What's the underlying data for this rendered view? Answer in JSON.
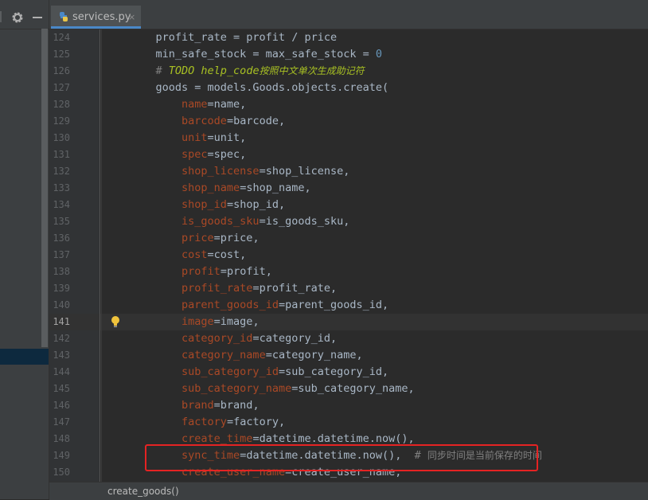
{
  "tab": {
    "file_name": "services.py",
    "close_glyph": "×",
    "icon": "python-file-icon"
  },
  "editor": {
    "current_line": 141,
    "lines": [
      {
        "n": "124",
        "parts": [
          {
            "t": "    profit_rate = profit / price",
            "c": ""
          }
        ]
      },
      {
        "n": "125",
        "parts": [
          {
            "t": "    min_safe_stock = max_safe_stock = ",
            "c": ""
          },
          {
            "t": "0",
            "c": "num"
          }
        ]
      },
      {
        "n": "126",
        "parts": [
          {
            "t": "    # ",
            "c": "cmt"
          },
          {
            "t": "TODO help_code",
            "c": "todo"
          },
          {
            "t": "按照中文单次生成助记符",
            "c": "todo cmt-cn"
          }
        ]
      },
      {
        "n": "127",
        "parts": [
          {
            "t": "    goods = models.Goods.objects.create(",
            "c": ""
          }
        ]
      },
      {
        "n": "128",
        "parts": [
          {
            "t": "        ",
            "c": ""
          },
          {
            "t": "name",
            "c": "kw"
          },
          {
            "t": "=name,",
            "c": ""
          }
        ]
      },
      {
        "n": "129",
        "parts": [
          {
            "t": "        ",
            "c": ""
          },
          {
            "t": "barcode",
            "c": "kw"
          },
          {
            "t": "=barcode,",
            "c": ""
          }
        ]
      },
      {
        "n": "130",
        "parts": [
          {
            "t": "        ",
            "c": ""
          },
          {
            "t": "unit",
            "c": "kw"
          },
          {
            "t": "=unit,",
            "c": ""
          }
        ]
      },
      {
        "n": "131",
        "parts": [
          {
            "t": "        ",
            "c": ""
          },
          {
            "t": "spec",
            "c": "kw"
          },
          {
            "t": "=spec,",
            "c": ""
          }
        ]
      },
      {
        "n": "132",
        "parts": [
          {
            "t": "        ",
            "c": ""
          },
          {
            "t": "shop_license",
            "c": "kw"
          },
          {
            "t": "=shop_license,",
            "c": ""
          }
        ]
      },
      {
        "n": "133",
        "parts": [
          {
            "t": "        ",
            "c": ""
          },
          {
            "t": "shop_name",
            "c": "kw"
          },
          {
            "t": "=shop_name,",
            "c": ""
          }
        ]
      },
      {
        "n": "134",
        "parts": [
          {
            "t": "        ",
            "c": ""
          },
          {
            "t": "shop_id",
            "c": "kw"
          },
          {
            "t": "=shop_id,",
            "c": ""
          }
        ]
      },
      {
        "n": "135",
        "parts": [
          {
            "t": "        ",
            "c": ""
          },
          {
            "t": "is_goods_sku",
            "c": "kw"
          },
          {
            "t": "=is_goods_sku,",
            "c": ""
          }
        ]
      },
      {
        "n": "136",
        "parts": [
          {
            "t": "        ",
            "c": ""
          },
          {
            "t": "price",
            "c": "kw"
          },
          {
            "t": "=price,",
            "c": ""
          }
        ]
      },
      {
        "n": "137",
        "parts": [
          {
            "t": "        ",
            "c": ""
          },
          {
            "t": "cost",
            "c": "kw"
          },
          {
            "t": "=cost,",
            "c": ""
          }
        ]
      },
      {
        "n": "138",
        "parts": [
          {
            "t": "        ",
            "c": ""
          },
          {
            "t": "profit",
            "c": "kw"
          },
          {
            "t": "=profit,",
            "c": ""
          }
        ]
      },
      {
        "n": "139",
        "parts": [
          {
            "t": "        ",
            "c": ""
          },
          {
            "t": "profit_rate",
            "c": "kw"
          },
          {
            "t": "=profit_rate,",
            "c": ""
          }
        ]
      },
      {
        "n": "140",
        "parts": [
          {
            "t": "        ",
            "c": ""
          },
          {
            "t": "parent_goods_id",
            "c": "kw"
          },
          {
            "t": "=parent_goods_id,",
            "c": ""
          }
        ]
      },
      {
        "n": "141",
        "parts": [
          {
            "t": "        ",
            "c": ""
          },
          {
            "t": "image",
            "c": "kw"
          },
          {
            "t": "=image,",
            "c": ""
          }
        ]
      },
      {
        "n": "142",
        "parts": [
          {
            "t": "        ",
            "c": ""
          },
          {
            "t": "category_id",
            "c": "kw"
          },
          {
            "t": "=category_id,",
            "c": ""
          }
        ]
      },
      {
        "n": "143",
        "parts": [
          {
            "t": "        ",
            "c": ""
          },
          {
            "t": "category_name",
            "c": "kw"
          },
          {
            "t": "=category_name,",
            "c": ""
          }
        ]
      },
      {
        "n": "144",
        "parts": [
          {
            "t": "        ",
            "c": ""
          },
          {
            "t": "sub_category_id",
            "c": "kw"
          },
          {
            "t": "=sub_category_id,",
            "c": ""
          }
        ]
      },
      {
        "n": "145",
        "parts": [
          {
            "t": "        ",
            "c": ""
          },
          {
            "t": "sub_category_name",
            "c": "kw"
          },
          {
            "t": "=sub_category_name,",
            "c": ""
          }
        ]
      },
      {
        "n": "146",
        "parts": [
          {
            "t": "        ",
            "c": ""
          },
          {
            "t": "brand",
            "c": "kw"
          },
          {
            "t": "=brand,",
            "c": ""
          }
        ]
      },
      {
        "n": "147",
        "parts": [
          {
            "t": "        ",
            "c": ""
          },
          {
            "t": "factory",
            "c": "kw"
          },
          {
            "t": "=factory,",
            "c": ""
          }
        ]
      },
      {
        "n": "148",
        "parts": [
          {
            "t": "        ",
            "c": ""
          },
          {
            "t": "create_time",
            "c": "kw"
          },
          {
            "t": "=datetime.datetime.now(),",
            "c": ""
          }
        ]
      },
      {
        "n": "149",
        "parts": [
          {
            "t": "        ",
            "c": ""
          },
          {
            "t": "sync_time",
            "c": "kw"
          },
          {
            "t": "=datetime.datetime.now(),  ",
            "c": ""
          },
          {
            "t": "# ",
            "c": "cmt"
          },
          {
            "t": "同步时间是当前保存的时间",
            "c": "cmt cmt-cn"
          }
        ]
      },
      {
        "n": "150",
        "parts": [
          {
            "t": "        ",
            "c": ""
          },
          {
            "t": "create_user_name",
            "c": "kw"
          },
          {
            "t": "=create_user_name,",
            "c": ""
          }
        ]
      }
    ]
  },
  "breadcrumb": {
    "label": "create_goods()"
  },
  "colors": {
    "keyword_arg": "#aa4926",
    "number": "#6897bb",
    "todo": "#a8c023",
    "highlight_box": "#e52323"
  }
}
